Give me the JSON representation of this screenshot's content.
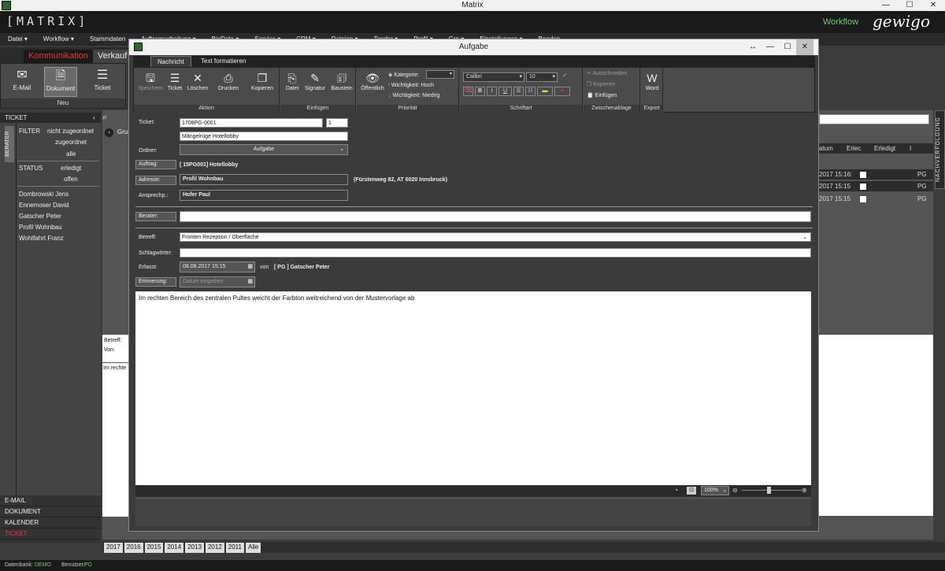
{
  "app": {
    "title": "Matrix",
    "brand": "[MATRIX]",
    "workflow": "Workflow",
    "logo": "gewigo"
  },
  "window_controls": {
    "min": "—",
    "max": "☐",
    "close": "✕"
  },
  "menu": [
    "Datei ▾",
    "Workflow ▾",
    "Stammdaten",
    "Auftragsarbeitung ▾",
    "BigData ▾",
    "Service ▾",
    "CRM ▾",
    "Dateien ▾",
    "Tender ▾",
    "Profil ▾",
    "Grp ▾",
    "Einstellungen ▾",
    "Benden"
  ],
  "tabs": {
    "kommunikation": "Kommunikation",
    "verkauf": "Verkauf"
  },
  "ribbon_left": {
    "email": "E-Mail",
    "dokument": "Dokument",
    "ticket": "Ticket",
    "group": "Neu"
  },
  "left": {
    "header": "TICKET",
    "berater": "BERATER",
    "filter": "FILTER",
    "nicht": "nicht zugeordnet",
    "zugeordnet": "zugeordnet",
    "alle": "alle",
    "status": "STATUS",
    "erledigt": "erledigt",
    "offen": "offen",
    "people": [
      "Dombrowski Jens",
      "Ennemoser David",
      "Gatscher Peter",
      "Profil Wohnbau",
      "Wohlfahrt Franz"
    ]
  },
  "bottomnav": [
    "E-MAIL",
    "DOKUMENT",
    "KALENDER",
    "TICKET"
  ],
  "years": [
    "2017",
    "2016",
    "2015",
    "2014",
    "2013",
    "2012",
    "2011",
    "Alle"
  ],
  "statusbar": {
    "db_label": "Datenbank:",
    "db": "DEMO",
    "user_label": "Benutzer:",
    "user": "PG"
  },
  "bg": {
    "cols": [
      "atum",
      "Erlec",
      "Erledigt",
      "I"
    ],
    "rows": [
      "2017 15:16:",
      "2017 15:15",
      "2017 15:15"
    ],
    "initials": "PG",
    "betreff": "Betreff:",
    "von": "Von:",
    "preview": "Im rechte",
    "gru": "Gru",
    "nachverfolgung": "NACHVERFOLGUNG"
  },
  "dialog": {
    "title": "Aufgabe",
    "resize": "↔",
    "tabs": [
      "Nachricht",
      "Text formatieren"
    ],
    "aktion": {
      "label": "Aktion",
      "buttons": [
        "Speichern",
        "Ticket",
        "Löschen",
        "Drucken",
        "Kopieren"
      ]
    },
    "einfuegen": {
      "label": "Einfügen",
      "buttons": [
        "Datei",
        "Signatur",
        "Baustein"
      ]
    },
    "prioritaet": {
      "label": "Priorität",
      "oeffentlich": "Öffentlich",
      "kategorie": "Kategorie:",
      "hoch": "Wichtigkeit: Hoch",
      "niedrig": "Wichtigkeit: Niedrig"
    },
    "schriftart": {
      "label": "Schriftart",
      "font": "Calibri",
      "size": "10"
    },
    "zwischenablage": {
      "label": "Zwischenablage",
      "cut": "Ausschneiden",
      "copy": "Kopieren",
      "paste": "Einfügen"
    },
    "export": {
      "label": "Export",
      "word": "Word"
    },
    "form": {
      "ticket_label": "Ticket:",
      "ticket_value": "1708PG-0001",
      "ticket_num": "1",
      "subject": "Mängelrüge Hotellobby",
      "ordner_label": "Ordner:",
      "ordner_value": "Aufgabe",
      "auftrag_label": "Auftrag:",
      "auftrag_value": "[ 15PG001] Hotellobby",
      "adresse_label": "Adresse:",
      "adresse_value": "Profil Wohnbau",
      "adresse_extra": "(Fürstenweg 82, AT 6020 Innsbruck)",
      "ansprech_label": "Ansprechp.:",
      "ansprech_value": "Hofer Paul",
      "berater_label": "Berater:",
      "betreff_label": "Betreff:",
      "betreff_value": "Fronten Rezeption / Oberfläche",
      "schlag_label": "Schlagwörter:",
      "erfasst_label": "Erfasst:",
      "erfasst_value": "08.08.2017 15:15",
      "von": "von",
      "von_value": "[ PG ] Gatscher Peter",
      "erinnerung_label": "Erinnerung:",
      "erinnerung_placeholder": "Datum eingeben"
    },
    "body": "Im rechten Bereich des zentralen Pultes weicht der Farbton weitreichend von der Mustervorlage ab",
    "zoom": "100%"
  }
}
